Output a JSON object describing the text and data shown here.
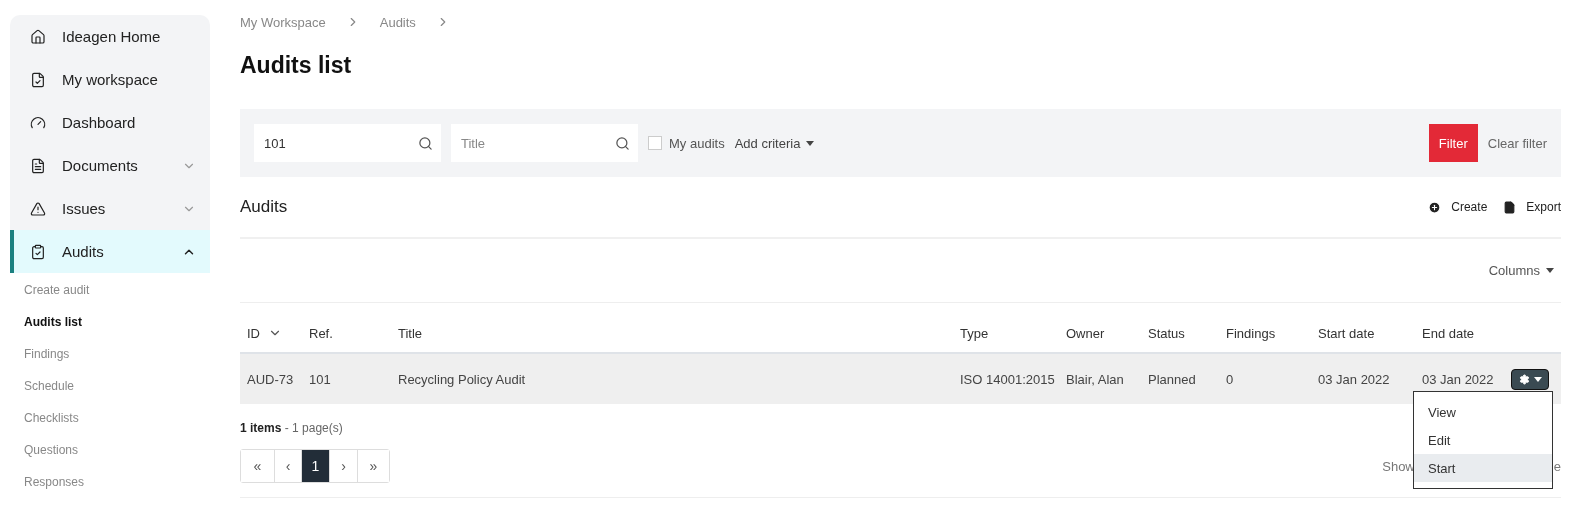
{
  "sidebar": {
    "items": [
      {
        "label": "Ideagen Home",
        "selected": false
      },
      {
        "label": "My workspace",
        "selected": false
      },
      {
        "label": "Dashboard",
        "selected": false
      },
      {
        "label": "Documents",
        "selected": false,
        "expanded": false
      },
      {
        "label": "Issues",
        "selected": false,
        "expanded": false
      },
      {
        "label": "Audits",
        "selected": true,
        "expanded": true,
        "children": [
          {
            "label": "Create audit",
            "selected": false
          },
          {
            "label": "Audits list",
            "selected": true
          },
          {
            "label": "Findings",
            "selected": false
          },
          {
            "label": "Schedule",
            "selected": false
          },
          {
            "label": "Checklists",
            "selected": false
          },
          {
            "label": "Questions",
            "selected": false
          },
          {
            "label": "Responses",
            "selected": false
          }
        ]
      }
    ]
  },
  "breadcrumb": [
    "My Workspace",
    "Audits"
  ],
  "page_title": "Audits list",
  "filter_bar": {
    "search_value": "101",
    "title_placeholder": "Title",
    "my_audits": {
      "label": "My audits",
      "checked": false
    },
    "add_criteria": "Add criteria",
    "filter_button": "Filter",
    "clear_button": "Clear filter"
  },
  "section": {
    "title": "Audits",
    "actions": [
      {
        "label": "Create"
      },
      {
        "label": "Export"
      }
    ],
    "columns_button": "Columns"
  },
  "table": {
    "columns": [
      {
        "label": "ID",
        "sorted": true
      },
      {
        "label": "Ref.",
        "sorted": false
      },
      {
        "label": "Title",
        "sorted": false
      },
      {
        "label": "Type",
        "sorted": false
      },
      {
        "label": "Owner",
        "sorted": false
      },
      {
        "label": "Status",
        "sorted": false
      },
      {
        "label": "Findings",
        "sorted": false
      },
      {
        "label": "Start date",
        "sorted": false
      },
      {
        "label": "End date",
        "sorted": false
      }
    ],
    "rows": [
      {
        "cells": [
          "AUD-73",
          "101",
          "Recycling Policy Audit",
          "ISO 14001:2015",
          "Blair, Alan",
          "Planned",
          "0",
          "03 Jan 2022",
          "03 Jan 2022"
        ],
        "selected": true
      }
    ]
  },
  "summary": {
    "count": "1 items",
    "separator": "-",
    "pages": "1 page(s)"
  },
  "pagination": [
    {
      "label": "«",
      "selected": false
    },
    {
      "label": "‹",
      "selected": false
    },
    {
      "label": "1",
      "selected": true
    },
    {
      "label": "›",
      "selected": false
    },
    {
      "label": "»",
      "selected": false
    }
  ],
  "page_size_texts": [
    "Show",
    "e"
  ],
  "action_menu": {
    "items": [
      {
        "label": "View",
        "selected": false
      },
      {
        "label": "Edit",
        "selected": false
      },
      {
        "label": "Start",
        "selected": true
      }
    ]
  }
}
